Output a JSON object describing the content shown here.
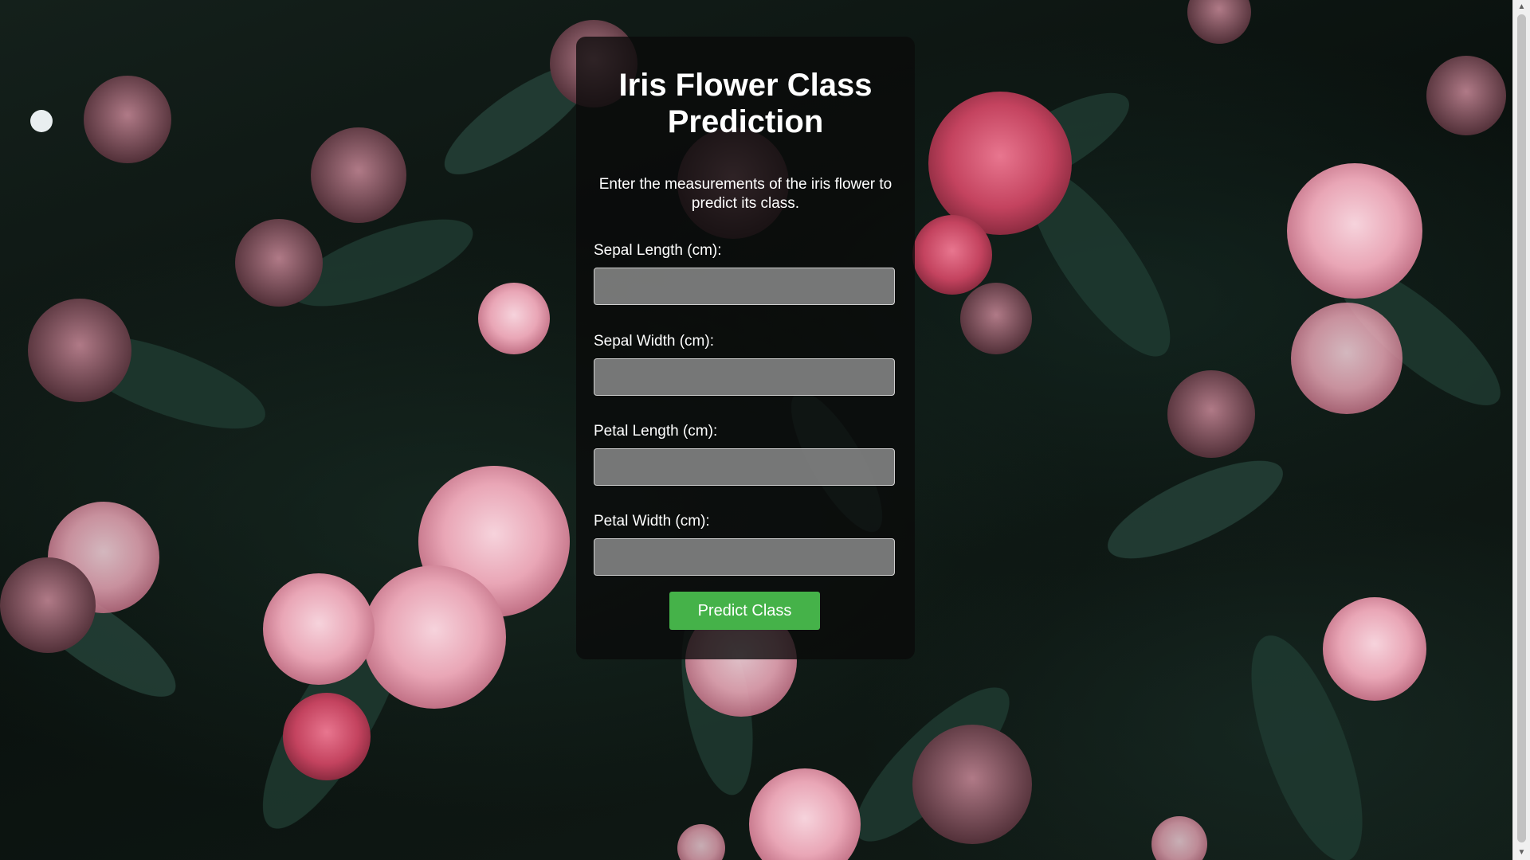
{
  "page": {
    "title": "Iris Flower Class Prediction",
    "subtitle": "Enter the measurements of the iris flower to predict its class."
  },
  "form": {
    "fields": [
      {
        "label": "Sepal Length (cm):",
        "value": "",
        "placeholder": ""
      },
      {
        "label": "Sepal Width (cm):",
        "value": "",
        "placeholder": ""
      },
      {
        "label": "Petal Length (cm):",
        "value": "",
        "placeholder": ""
      },
      {
        "label": "Petal Width (cm):",
        "value": "",
        "placeholder": ""
      }
    ],
    "submit_label": "Predict Class"
  },
  "background": {
    "description_icon": "pink-camellia-flowers-photo"
  },
  "colors": {
    "button": "#45b249",
    "card": "rgba(10,10,10,0.78)",
    "input": "rgba(150,150,150,0.78)"
  },
  "scrollbar": {
    "up_icon": "▲",
    "down_icon": "▼"
  }
}
